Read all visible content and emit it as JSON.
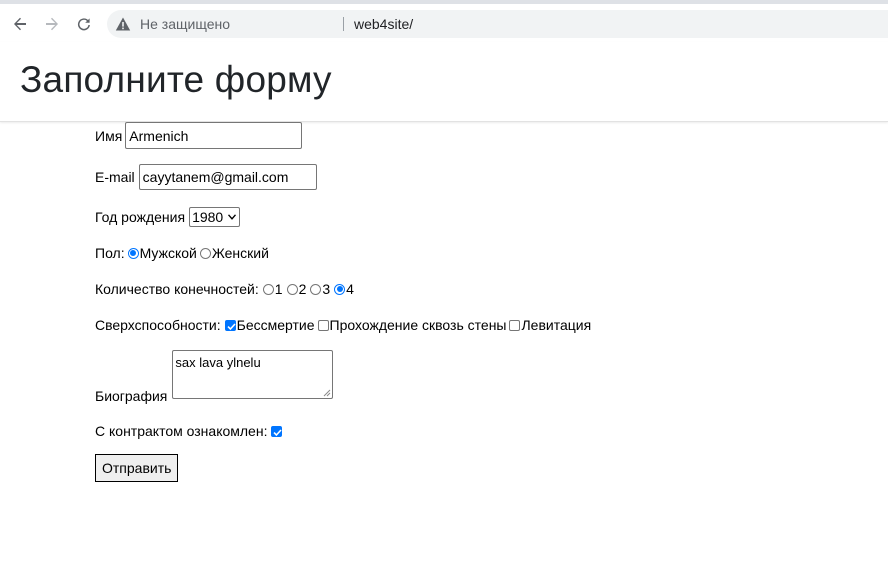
{
  "browser": {
    "security_label": "Не защищено",
    "url": "web4site/"
  },
  "page": {
    "title": "Заполните форму"
  },
  "form": {
    "name": {
      "label": "Имя",
      "value": "Armenich"
    },
    "email": {
      "label": "E-mail",
      "value": "cayytanem@gmail.com"
    },
    "birth_year": {
      "label": "Год рождения",
      "selected": "1980"
    },
    "gender": {
      "label": "Пол:",
      "options": [
        {
          "label": "Мужской",
          "checked": true
        },
        {
          "label": "Женский",
          "checked": false
        }
      ]
    },
    "limbs": {
      "label": "Количество конечностей:",
      "options": [
        {
          "label": "1",
          "checked": false
        },
        {
          "label": "2",
          "checked": false
        },
        {
          "label": "3",
          "checked": false
        },
        {
          "label": "4",
          "checked": true
        }
      ]
    },
    "superpowers": {
      "label": "Сверхспособности:",
      "options": [
        {
          "label": "Бессмертие",
          "checked": true
        },
        {
          "label": "Прохождение сквозь стены",
          "checked": false
        },
        {
          "label": "Левитация",
          "checked": false
        }
      ]
    },
    "biography": {
      "label": "Биография",
      "value": "sax lava ylnelu"
    },
    "contract": {
      "label": "С контрактом ознакомлен:",
      "checked": true
    },
    "submit_label": "Отправить"
  },
  "colors": {
    "accent": "#0075ff",
    "omnibox_bg": "#f1f3f4"
  }
}
